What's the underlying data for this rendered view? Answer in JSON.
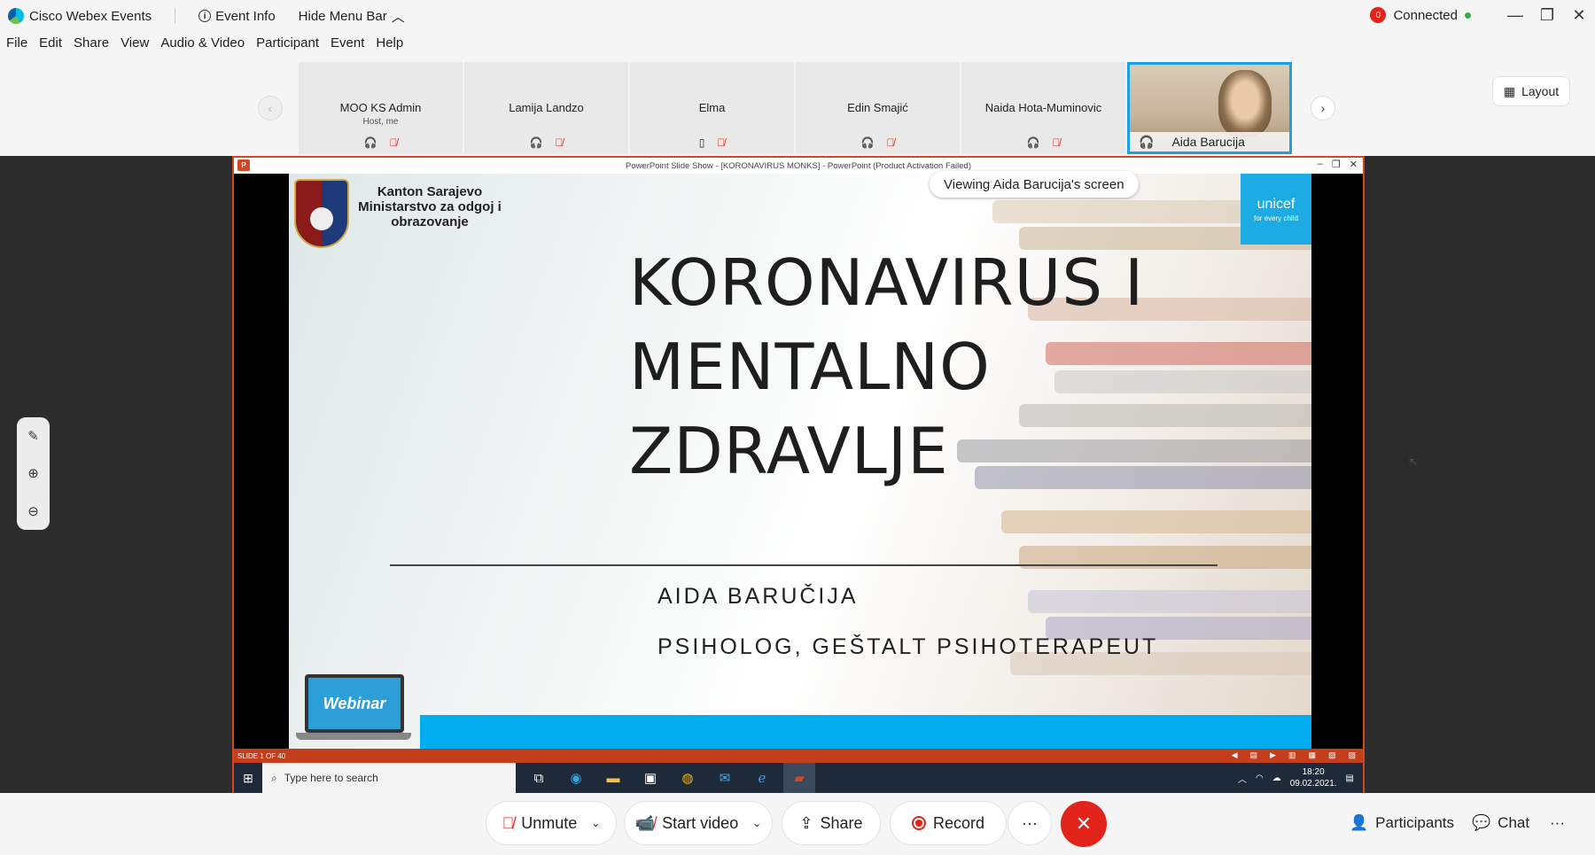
{
  "titlebar": {
    "app_name": "Cisco Webex Events",
    "event_info": "Event Info",
    "hide_menu": "Hide Menu Bar",
    "connection_badge": "0",
    "connection_status": "Connected"
  },
  "menu": [
    "File",
    "Edit",
    "Share",
    "View",
    "Audio & Video",
    "Participant",
    "Event",
    "Help"
  ],
  "participants": [
    {
      "name": "MOO KS Admin",
      "sub": "Host, me"
    },
    {
      "name": "Lamija Landzo",
      "sub": ""
    },
    {
      "name": "Elma",
      "sub": ""
    },
    {
      "name": "Edin Smajić",
      "sub": ""
    },
    {
      "name": "Naida Hota-Muminovic",
      "sub": ""
    },
    {
      "name": "Aida Barucija",
      "sub": ""
    }
  ],
  "layout_label": "Layout",
  "share": {
    "window_title": "PowerPoint Slide Show - [KORONAVIRUS MONKS] - PowerPoint (Product Activation Failed)",
    "viewing_label": "Viewing Aida Barucija's screen",
    "slide_status": "SLIDE 1 OF 40",
    "taskbar_search": "Type here to search",
    "clock_time": "18:20",
    "clock_date": "09.02.2021."
  },
  "slide": {
    "org_line1": "Kanton Sarajevo",
    "org_line2": "Ministarstvo za odgoj i obrazovanje",
    "unicef_name": "unicef",
    "unicef_tagline": "for every child",
    "title_line1": "KORONAVIRUS I",
    "title_line2": "MENTALNO",
    "title_line3": "ZDRAVLJE",
    "author": "AIDA BARUČIJA",
    "role": "PSIHOLOG, GEŠTALT PSIHOTERAPEUT",
    "webinar_label": "Webinar",
    "colors": {
      "accent": "#00aeef",
      "unicef": "#1cabe2",
      "ppt": "#c43e1c"
    }
  },
  "controls": {
    "unmute": "Unmute",
    "start_video": "Start video",
    "share": "Share",
    "record": "Record",
    "more": "···",
    "participants": "Participants",
    "chat": "Chat"
  }
}
